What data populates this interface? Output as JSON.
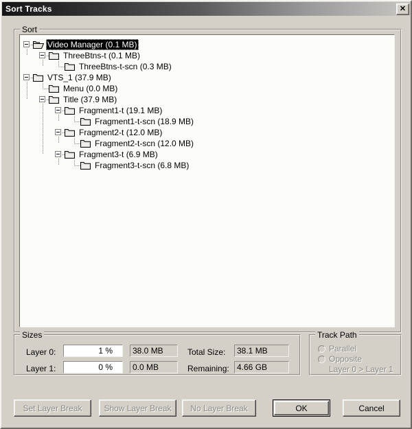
{
  "window": {
    "title": "Sort Tracks",
    "close_label": "✕"
  },
  "sort_group": {
    "label": "Sort",
    "tree": [
      {
        "label": "Video Manager (0.1 MB)",
        "depth": 0,
        "expander": true,
        "folder": "open",
        "selected": true
      },
      {
        "label": "ThreeBtns-t (0.1 MB)",
        "depth": 1,
        "expander": true,
        "folder": "closed",
        "selected": false
      },
      {
        "label": "ThreeBtns-t-scn (0.3 MB)",
        "depth": 2,
        "expander": false,
        "folder": "closed",
        "selected": false
      },
      {
        "label": "VTS_1 (37.9 MB)",
        "depth": 0,
        "expander": true,
        "folder": "closed",
        "selected": false
      },
      {
        "label": "Menu (0.0 MB)",
        "depth": 1,
        "expander": false,
        "folder": "closed",
        "selected": false
      },
      {
        "label": "Title (37.9 MB)",
        "depth": 1,
        "expander": true,
        "folder": "closed",
        "selected": false
      },
      {
        "label": "Fragment1-t (19.1 MB)",
        "depth": 2,
        "expander": true,
        "folder": "closed",
        "selected": false
      },
      {
        "label": "Fragment1-t-scn (18.9 MB)",
        "depth": 3,
        "expander": false,
        "folder": "closed",
        "selected": false
      },
      {
        "label": "Fragment2-t (12.0 MB)",
        "depth": 2,
        "expander": true,
        "folder": "closed",
        "selected": false
      },
      {
        "label": "Fragment2-t-scn (12.0 MB)",
        "depth": 3,
        "expander": false,
        "folder": "closed",
        "selected": false
      },
      {
        "label": "Fragment3-t (6.9 MB)",
        "depth": 2,
        "expander": true,
        "folder": "closed",
        "selected": false
      },
      {
        "label": "Fragment3-t-scn (6.8 MB)",
        "depth": 3,
        "expander": false,
        "folder": "closed",
        "selected": false
      }
    ]
  },
  "sizes_group": {
    "label": "Sizes",
    "layer0_label": "Layer 0:",
    "layer0_percent": "1 %",
    "layer0_size": "38.0 MB",
    "layer1_label": "Layer 1:",
    "layer1_percent": "0 %",
    "layer1_size": "0.0 MB",
    "total_size_label": "Total Size:",
    "total_size_value": "38.1 MB",
    "remaining_label": "Remaining:",
    "remaining_value": "4.66 GB"
  },
  "track_path_group": {
    "label": "Track Path",
    "parallel_label": "Parallel",
    "opposite_label": "Opposite",
    "layer_order_text": "Layer 0 > Layer 1"
  },
  "buttons": {
    "set_layer_break": "Set Layer Break",
    "show_layer_break": "Show Layer Break",
    "no_layer_break": "No Layer Break",
    "ok": "OK",
    "cancel": "Cancel"
  },
  "colors": {
    "dialog_face": "#d4d0c8",
    "tree_background": "#fcfcf8",
    "selection_background": "#000000",
    "selection_text": "#ffffff",
    "disabled_text": "#8d8a86"
  }
}
